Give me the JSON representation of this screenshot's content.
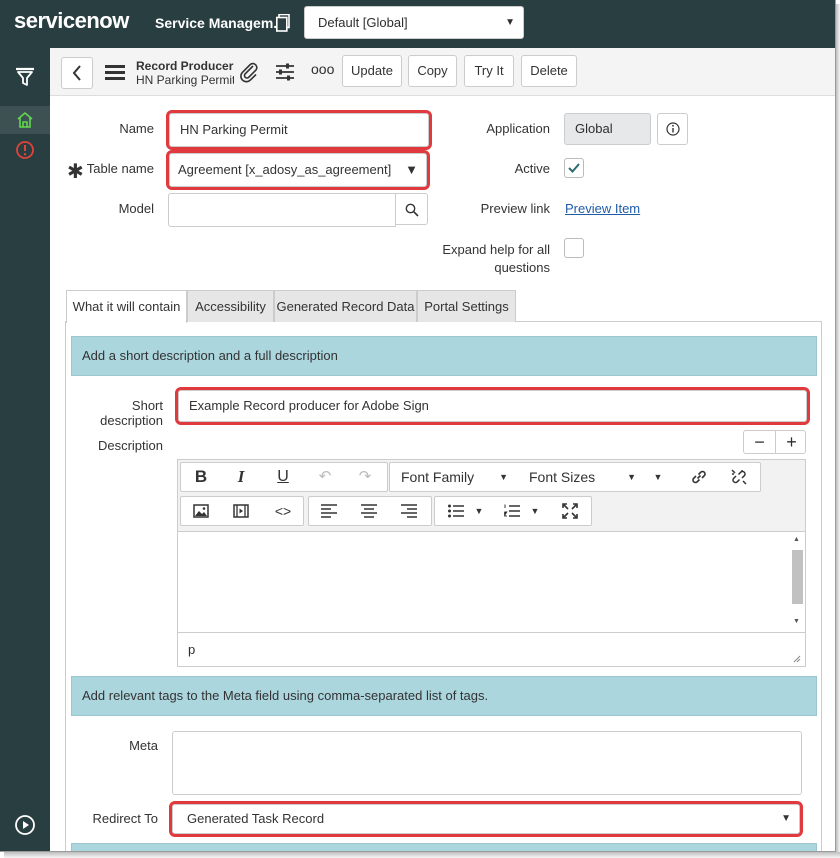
{
  "banner": {
    "logo": "servicenow",
    "app_title": "Service Managem...",
    "scope_selector": "Default [Global]"
  },
  "header": {
    "form_type": "Record Producer",
    "form_name": "HN Parking Permit",
    "buttons": {
      "update": "Update",
      "copy": "Copy",
      "try_it": "Try It",
      "delete": "Delete"
    },
    "more_label": "ooo"
  },
  "fields": {
    "name": {
      "label": "Name",
      "value": "HN Parking Permit"
    },
    "table_name": {
      "label": "Table name",
      "value": "Agreement [x_adosy_as_agreement]",
      "required": true
    },
    "model": {
      "label": "Model",
      "value": ""
    },
    "application": {
      "label": "Application",
      "value": "Global"
    },
    "active": {
      "label": "Active",
      "checked": true
    },
    "preview_link": {
      "label": "Preview link",
      "link_text": "Preview Item"
    },
    "expand_help": {
      "label_line1": "Expand help for all",
      "label_line2": "questions",
      "checked": false
    }
  },
  "tabs": [
    {
      "label": "What it will contain",
      "active": true
    },
    {
      "label": "Accessibility",
      "active": false
    },
    {
      "label": "Generated Record Data",
      "active": false
    },
    {
      "label": "Portal Settings",
      "active": false
    }
  ],
  "panel": {
    "info_message_1": "Add a short description and a full description",
    "short_description": {
      "label": "Short description",
      "value": "Example Record producer for Adobe Sign"
    },
    "description": {
      "label": "Description",
      "status_path": "p"
    },
    "editor_toolbar": {
      "bold": "B",
      "italic": "I",
      "underline": "U",
      "font_family": "Font Family",
      "font_sizes": "Font Sizes"
    },
    "zoom": {
      "minus": "−",
      "plus": "+"
    },
    "info_message_2": "Add relevant tags to the Meta field using comma-separated list of tags.",
    "meta": {
      "label": "Meta",
      "value": ""
    },
    "redirect_to": {
      "label": "Redirect To",
      "value": "Generated Task Record"
    }
  },
  "colors": {
    "banner_bg": "#293e40",
    "info_bg": "#abd6de",
    "highlight": "#e03a3e",
    "link": "#1f5ca8"
  }
}
